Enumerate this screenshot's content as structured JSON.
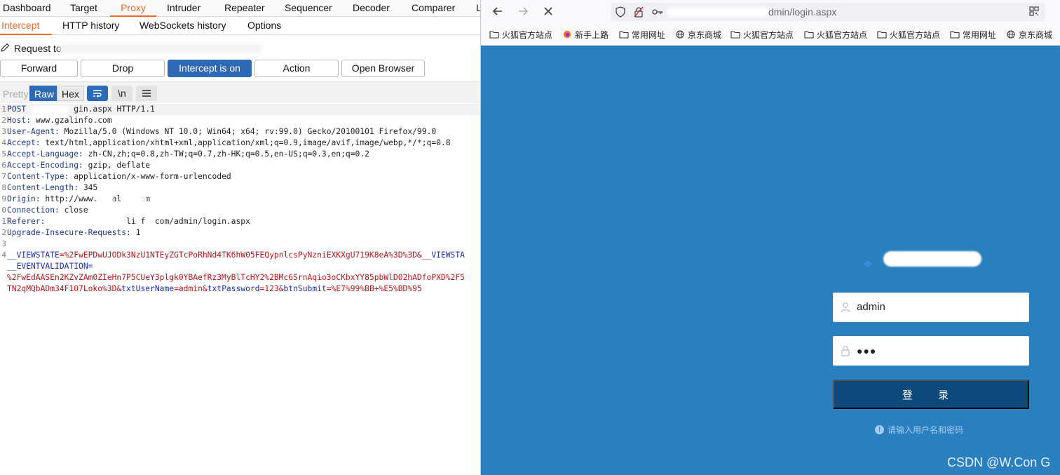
{
  "burp": {
    "main_tabs": [
      "Dashboard",
      "Target",
      "Proxy",
      "Intruder",
      "Repeater",
      "Sequencer",
      "Decoder",
      "Comparer",
      "L"
    ],
    "sub_tabs": [
      "Intercept",
      "HTTP history",
      "WebSockets history",
      "Options"
    ],
    "request_label": "Request to",
    "buttons": {
      "forward": "Forward",
      "drop": "Drop",
      "intercept": "Intercept is on",
      "action": "Action",
      "open_browser": "Open Browser"
    },
    "editor_tabs": [
      "Pretty",
      "Raw",
      "Hex"
    ],
    "editor_icons": {
      "wrap": "wrap-icon",
      "newline": "\\n",
      "menu": "menu-icon"
    },
    "request_lines": [
      {
        "num": "1",
        "key": "POST",
        "value": "          gin.aspx HTTP/1.1"
      },
      {
        "num": "2",
        "key": "Host:",
        "value": " www.gzalinfo.com"
      },
      {
        "num": "3",
        "key": "User-Agent:",
        "value": " Mozilla/5.0 (Windows NT 10.0; Win64; x64; rv:99.0) Gecko/20100101 Firefox/99.0"
      },
      {
        "num": "4",
        "key": "Accept:",
        "value": " text/html,application/xhtml+xml,application/xml;q=0.9,image/avif,image/webp,*/*;q=0.8"
      },
      {
        "num": "5",
        "key": "Accept-Language:",
        "value": " zh-CN,zh;q=0.8,zh-TW;q=0.7,zh-HK;q=0.5,en-US;q=0.3,en;q=0.2"
      },
      {
        "num": "6",
        "key": "Accept-Encoding:",
        "value": " gzip, deflate"
      },
      {
        "num": "7",
        "key": "Content-Type:",
        "value": " application/x-www-form-urlencoded"
      },
      {
        "num": "8",
        "key": "Content-Length:",
        "value": " 345"
      },
      {
        "num": "9",
        "key": "Origin:",
        "value": " http://www.   al    om"
      },
      {
        "num": "0",
        "key": "Connection:",
        "value": " close"
      },
      {
        "num": "1",
        "key": "Referer:",
        "value": "                 li f  com/admin/login.aspx"
      },
      {
        "num": "2",
        "key": "Upgrade-Insecure-Requests:",
        "value": " 1"
      },
      {
        "num": "3",
        "key": "",
        "value": ""
      }
    ],
    "body_lines": [
      {
        "num": "4",
        "parts": [
          [
            "k",
            "__VIEWSTATE"
          ],
          [
            "v",
            "=%2FwEPDwUJODk3NzU1NTEyZGTcPoRhNd4TK6hW05FEQypnlcsPyNzniEXKXgU719K8eA%3D%3D&"
          ],
          [
            "k",
            "__VIEWSTA"
          ]
        ]
      },
      {
        "num": "",
        "parts": [
          [
            "k",
            "__EVENTVALIDATION"
          ],
          [
            "e",
            "="
          ]
        ]
      },
      {
        "num": "",
        "parts": [
          [
            "v",
            "%2FwEdAASEn2KZvZAm0ZIeHn7P5CUeY3plgk0YBAefRz3MyBlTcHY2%2BMc6SrnAqio3oCKbxYY85pbWlD02hADfoPXD%2F5"
          ]
        ]
      },
      {
        "num": "",
        "parts": [
          [
            "v",
            "TN2qMQbADm34F107Loko%3D&"
          ],
          [
            "k",
            "txtUserName"
          ],
          [
            "v",
            "=admin&"
          ],
          [
            "k",
            "txtPassword"
          ],
          [
            "v",
            "=123&"
          ],
          [
            "k",
            "btnSubmit"
          ],
          [
            "v",
            "=%E7%99%BB+%E5%BD%95"
          ]
        ]
      }
    ]
  },
  "firefox": {
    "url": "dmin/login.aspx",
    "bookmarks": [
      "火狐官方站点",
      "新手上路",
      "常用网址",
      "京东商城",
      "火狐官方站点",
      "火狐官方站点",
      "火狐官方站点",
      "常用网址",
      "京东商城"
    ],
    "login": {
      "username_value": "admin",
      "password_value": "●●●",
      "submit_label": "登 录",
      "hint": "请输入用户名和密码"
    },
    "watermark": "CSDN @W.Con G"
  },
  "colors": {
    "burp_accent": "#f06a28",
    "burp_blue": "#2d6ab3",
    "login_bg": "#2a7fbf",
    "login_btn": "#0d4a7b"
  }
}
